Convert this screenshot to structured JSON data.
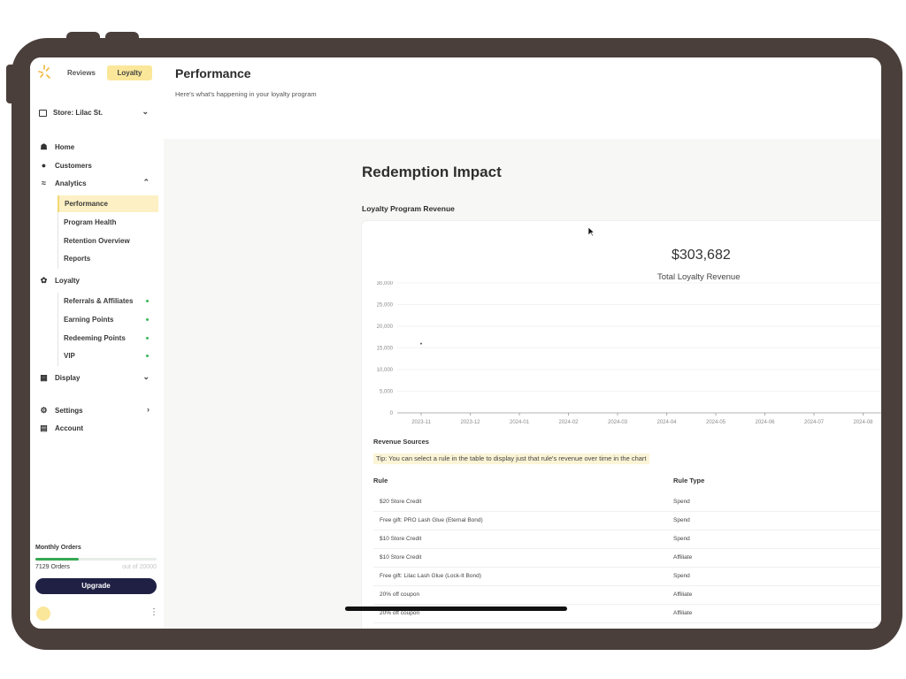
{
  "top_tabs": [
    "Reviews",
    "Loyalty"
  ],
  "store": {
    "label": "Store: Lilac St."
  },
  "nav": {
    "home": "Home",
    "customers": "Customers",
    "analytics": "Analytics",
    "analytics_items": [
      "Performance",
      "Program Health",
      "Retention Overview",
      "Reports"
    ],
    "loyalty": "Loyalty",
    "loyalty_items": [
      "Referrals & Affiliates",
      "Earning Points",
      "Redeeming Points",
      "VIP"
    ],
    "display": "Display",
    "settings": "Settings",
    "account": "Account"
  },
  "usage": {
    "label": "Monthly Orders",
    "orders": "7129 Orders",
    "limit": "out of 20000",
    "progress": 0.356,
    "upgrade": "Upgrade"
  },
  "header": {
    "title": "Performance",
    "subtitle": "Here's what's happening in your loyalty program"
  },
  "section": {
    "title": "Redemption Impact",
    "chart_title": "Loyalty Program Revenue",
    "total": "$303,682",
    "total_label": "Total Loyalty Revenue"
  },
  "chart_data": {
    "type": "line",
    "x": [
      "2023-11",
      "2023-12",
      "2024-01",
      "2024-02",
      "2024-03",
      "2024-04",
      "2024-05",
      "2024-06",
      "2024-07",
      "2024-08"
    ],
    "y_ticks": [
      "30,000",
      "25,000",
      "20,000",
      "15,000",
      "10,000",
      "5,000",
      "0"
    ],
    "ylim": [
      0,
      30000
    ],
    "points": [
      {
        "x": "2023-11",
        "y": 16000
      }
    ],
    "grid": true
  },
  "revenue_sources": {
    "title": "Revenue Sources",
    "tip": "Tip: You can select a rule in the table to display just that rule's revenue over time in the chart",
    "columns": [
      "Rule",
      "Rule Type"
    ],
    "rows": [
      [
        "$20 Store Credit",
        "Spend"
      ],
      [
        "Free gift: PRO Lash Glue (Eternal Bond)",
        "Spend"
      ],
      [
        "$10 Store Credit",
        "Spend"
      ],
      [
        "$10 Store Credit",
        "Affiliate"
      ],
      [
        "Free gift: Lilac Lash Glue (Lock-It Bond)",
        "Spend"
      ],
      [
        "20% off coupon",
        "Affiliate"
      ],
      [
        "20% off coupon",
        "Affiliate"
      ]
    ]
  },
  "colors": {
    "accent": "#fbe79a",
    "upgrade_bg": "#1f2044",
    "progress": "#35a853",
    "frame": "#4a3f3b"
  }
}
